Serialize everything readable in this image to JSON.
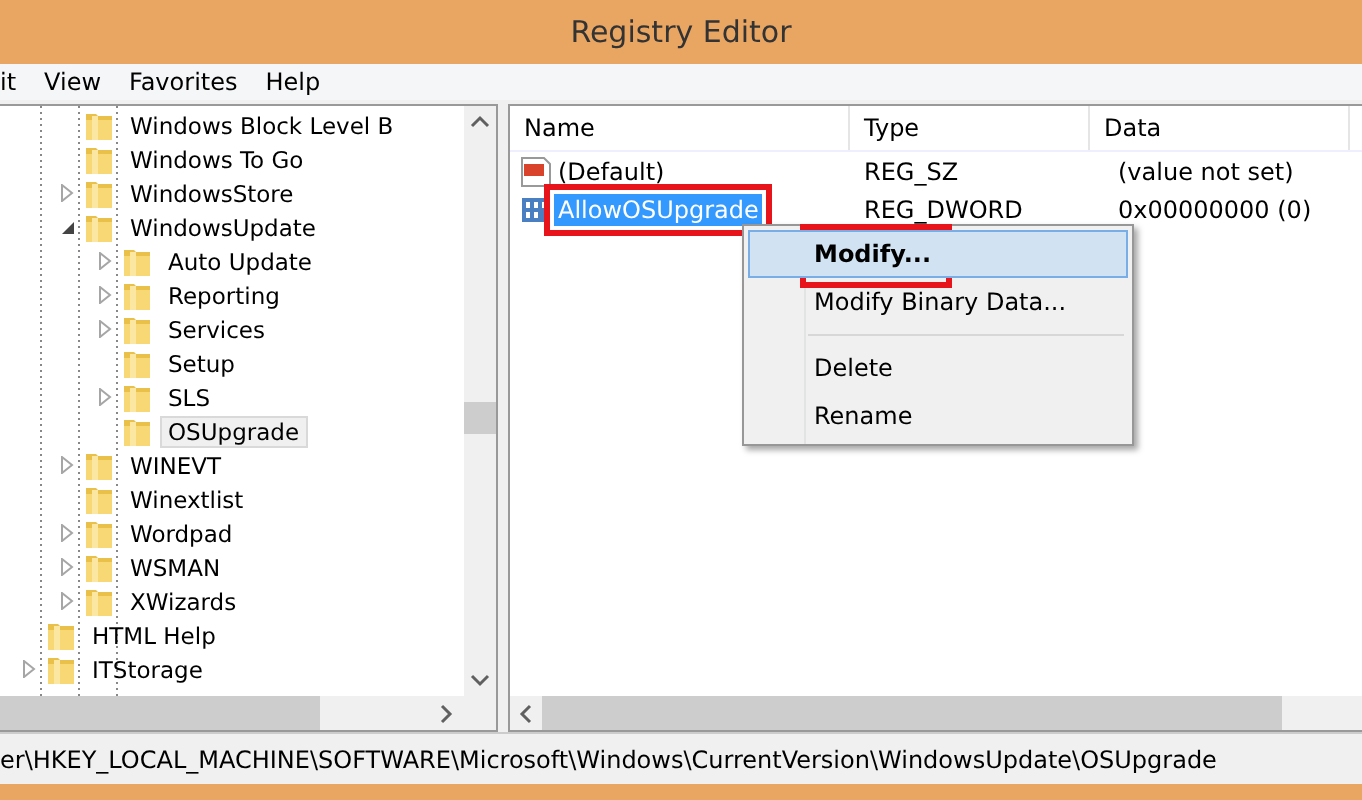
{
  "window": {
    "title": "Registry Editor"
  },
  "menu_bar": [
    "it",
    "View",
    "Favorites",
    "Help"
  ],
  "tree": {
    "scrolled_items": [
      {
        "label": "Windows Block Level B",
        "kind": "leaf",
        "selected": false
      },
      {
        "label": "Windows To Go",
        "kind": "leaf",
        "selected": false
      },
      {
        "label": "WindowsStore",
        "kind": "collapsed",
        "selected": false
      },
      {
        "label": "WindowsUpdate",
        "kind": "expanded",
        "selected": false,
        "children": [
          {
            "label": "Auto Update",
            "kind": "collapsed",
            "selected": false
          },
          {
            "label": "Reporting",
            "kind": "collapsed",
            "selected": false
          },
          {
            "label": "Services",
            "kind": "collapsed",
            "selected": false
          },
          {
            "label": "Setup",
            "kind": "leaf",
            "selected": false
          },
          {
            "label": "SLS",
            "kind": "collapsed",
            "selected": false
          },
          {
            "label": "OSUpgrade",
            "kind": "leaf",
            "selected": true
          }
        ]
      },
      {
        "label": "WINEVT",
        "kind": "collapsed",
        "selected": false
      },
      {
        "label": "Winextlist",
        "kind": "leaf",
        "selected": false
      },
      {
        "label": "Wordpad",
        "kind": "collapsed",
        "selected": false
      },
      {
        "label": "WSMAN",
        "kind": "collapsed",
        "selected": false
      },
      {
        "label": "XWizards",
        "kind": "collapsed",
        "selected": false
      }
    ],
    "items": [
      {
        "label": "HTML Help",
        "kind": "leaf",
        "selected": false
      },
      {
        "label": "ITStorage",
        "kind": "collapsed",
        "selected": false
      }
    ]
  },
  "values": {
    "columns": [
      "Name",
      "Type",
      "Data"
    ],
    "rows": [
      {
        "name": "(Default)",
        "type": "REG_SZ",
        "data": "(value not set)",
        "kind": "string",
        "selected": false,
        "annotated": false
      },
      {
        "name": "AllowOSUpgrade",
        "type": "REG_DWORD",
        "data": "0x00000000 (0)",
        "kind": "binary",
        "selected": true,
        "annotated": true
      }
    ]
  },
  "context_menu": [
    {
      "kind": "item",
      "label": "Modify...",
      "default": true,
      "selected": true,
      "annotated": true
    },
    {
      "kind": "item",
      "label": "Modify Binary Data...",
      "default": false,
      "selected": false,
      "annotated": false
    },
    {
      "kind": "separator"
    },
    {
      "kind": "item",
      "label": "Delete",
      "default": false,
      "selected": false,
      "annotated": false
    },
    {
      "kind": "item",
      "label": "Rename",
      "default": false,
      "selected": false,
      "annotated": false
    }
  ],
  "status_bar": "er\\HKEY_LOCAL_MACHINE\\SOFTWARE\\Microsoft\\Windows\\CurrentVersion\\WindowsUpdate\\OSUpgrade"
}
